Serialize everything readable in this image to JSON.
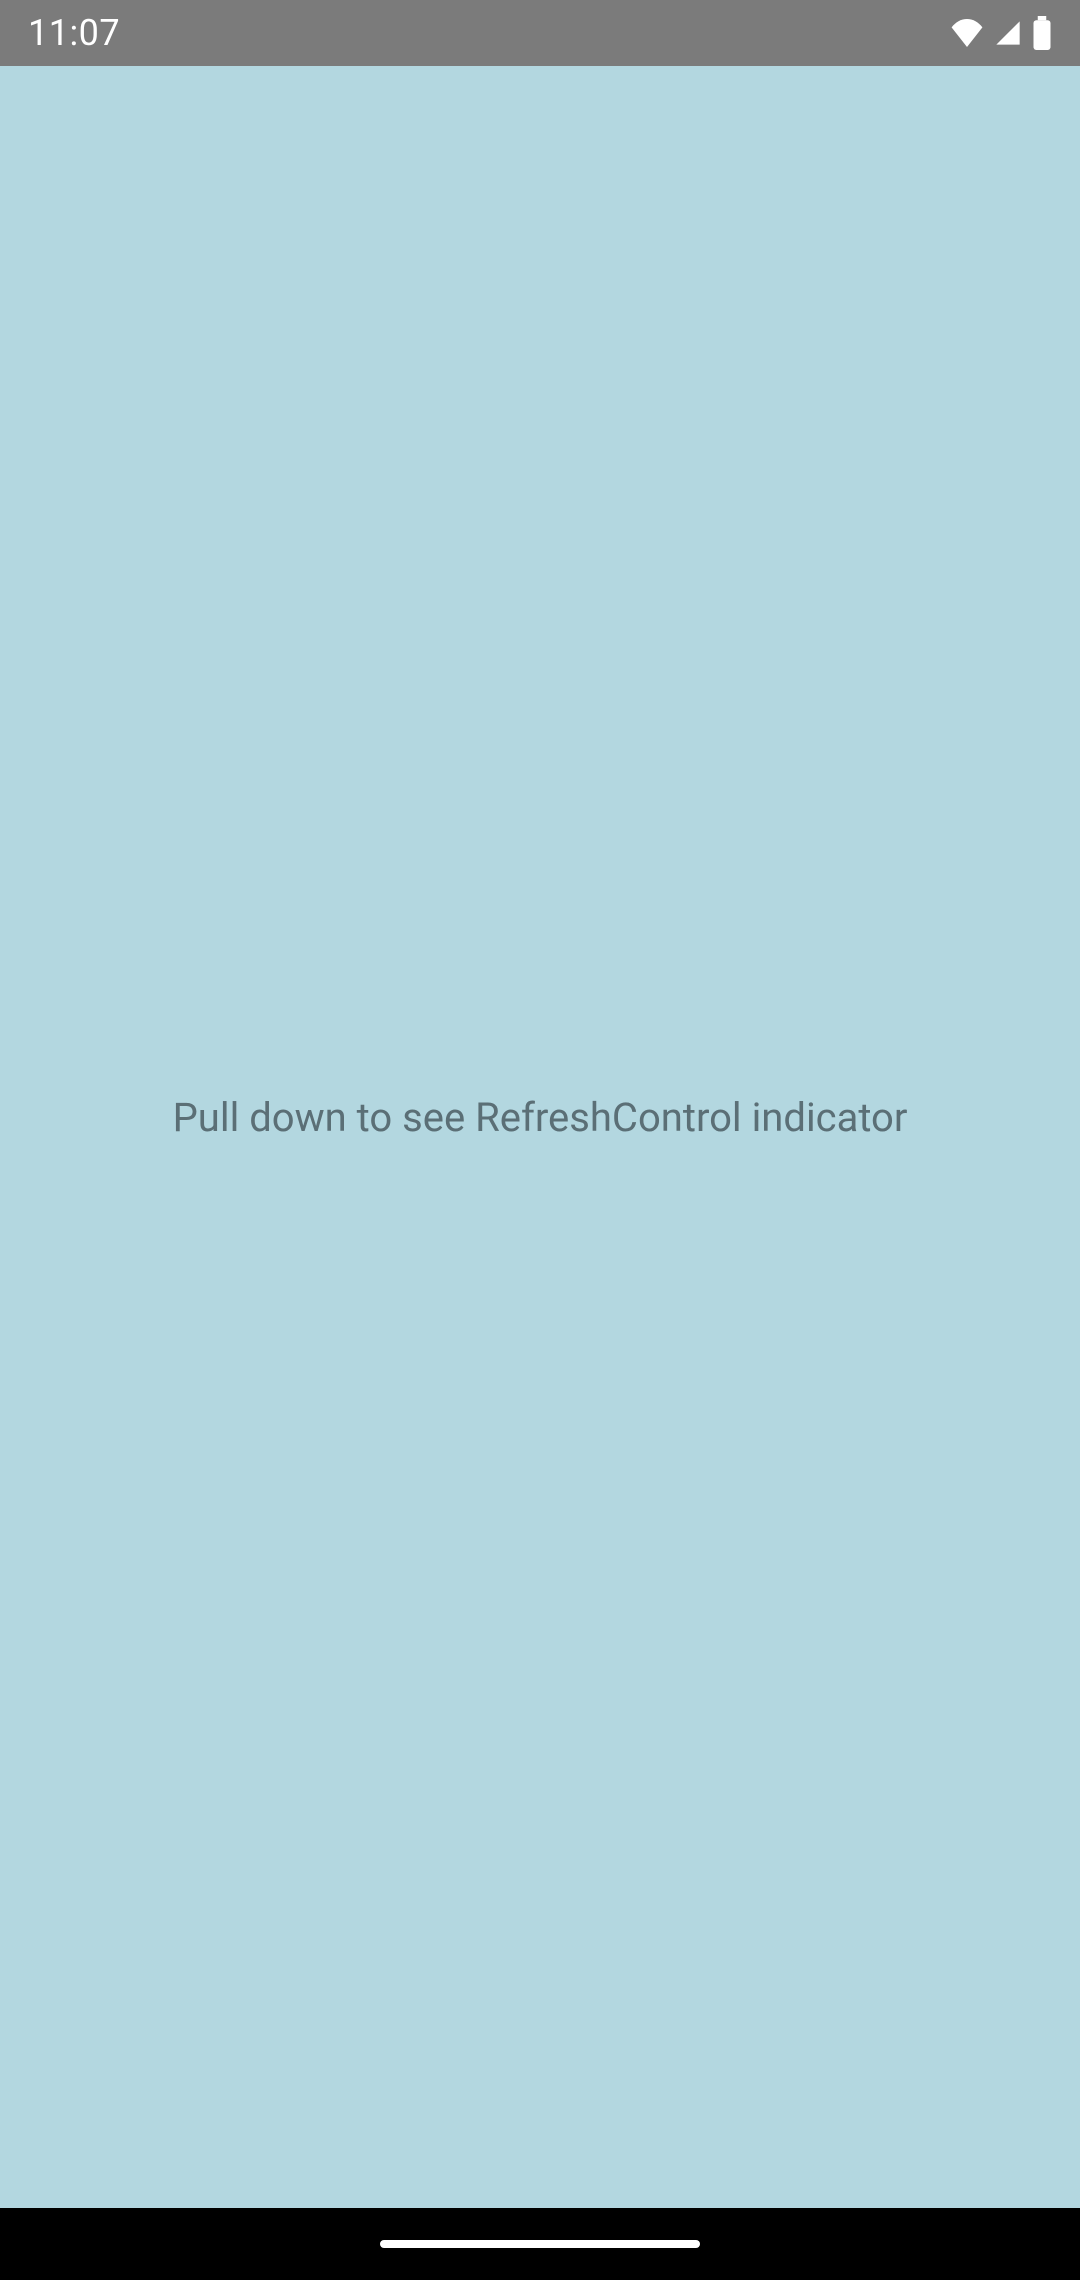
{
  "status_bar": {
    "time": "11:07",
    "icons": {
      "wifi": "wifi",
      "signal": "signal",
      "battery": "battery"
    }
  },
  "content": {
    "hint_text": "Pull down to see RefreshControl indicator"
  },
  "colors": {
    "status_bar_bg": "#7b7b7b",
    "app_bg": "#b3d7e0",
    "hint_text": "#5b6f76",
    "nav_bg": "#000000"
  }
}
